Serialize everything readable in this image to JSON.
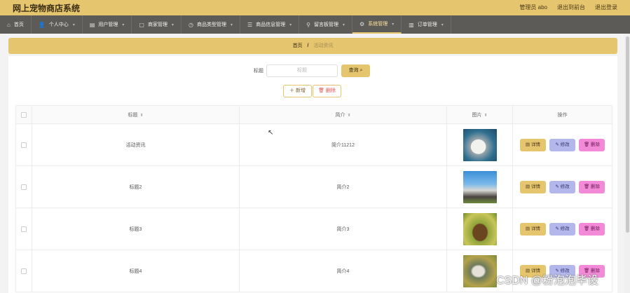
{
  "header": {
    "title": "网上宠物商店系统",
    "admin_label": "管理员 abo",
    "front_link": "退出到前台",
    "logout_link": "退出登录"
  },
  "nav": {
    "items": [
      {
        "label": "首页",
        "icon": "home-icon"
      },
      {
        "label": "个人中心",
        "icon": "user-icon"
      },
      {
        "label": "用户管理",
        "icon": "users-icon"
      },
      {
        "label": "商家管理",
        "icon": "shop-icon"
      },
      {
        "label": "商品类型管理",
        "icon": "tag-icon"
      },
      {
        "label": "商品信息管理",
        "icon": "list-icon"
      },
      {
        "label": "留言板管理",
        "icon": "pin-icon"
      },
      {
        "label": "系统管理",
        "icon": "gear-icon"
      },
      {
        "label": "订单管理",
        "icon": "order-icon"
      }
    ],
    "active_index": 7
  },
  "breadcrumb": {
    "home": "首页",
    "separator": "/",
    "current": "活动资讯"
  },
  "search": {
    "label": "标题",
    "placeholder": "标题",
    "button": "查询"
  },
  "actions": {
    "add": "新增",
    "delete": "删除"
  },
  "table": {
    "columns": [
      "标题",
      "简介",
      "图片",
      "操作"
    ],
    "rows": [
      {
        "title": "活动资讯",
        "intro": "简介11212",
        "image": "white-puppy-photo"
      },
      {
        "title": "标题2",
        "intro": "简介2",
        "image": "husky-photo"
      },
      {
        "title": "标题3",
        "intro": "简介3",
        "image": "brown-dog-photo"
      },
      {
        "title": "标题4",
        "intro": "简介4",
        "image": "cat-photo"
      }
    ],
    "row_actions": {
      "detail": "详情",
      "edit": "修改",
      "remove": "删除"
    }
  },
  "watermark": "CSDN @粉泡泡毕设",
  "colors": {
    "accent": "#e6c56f",
    "nav_bg": "#5d5b58",
    "edit_btn": "#b3b7ec",
    "remove_btn": "#f28ad7"
  }
}
